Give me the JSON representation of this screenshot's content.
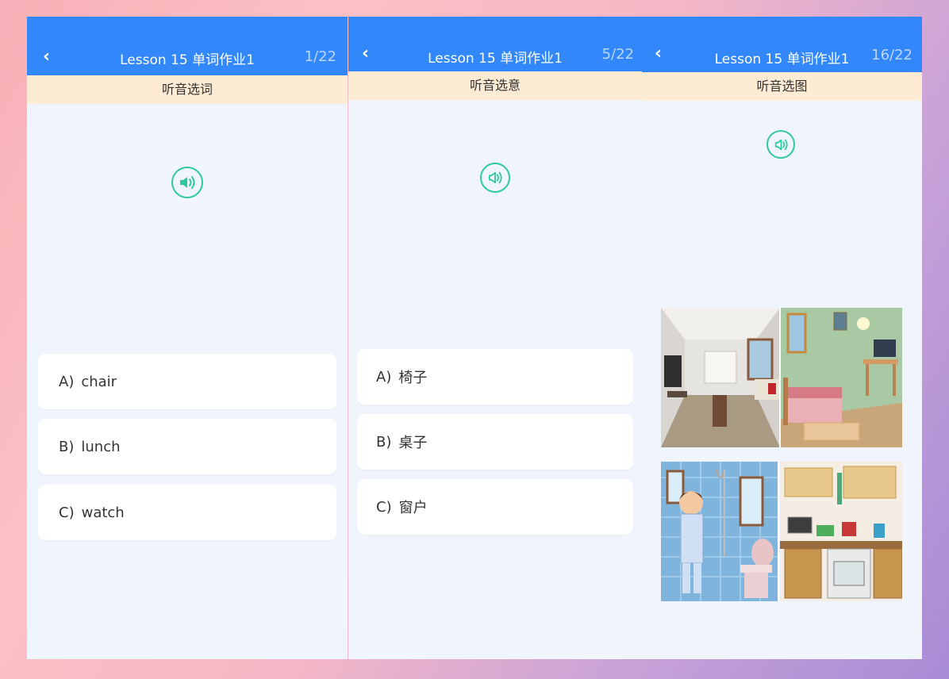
{
  "colors": {
    "header": "#3288fb",
    "subheader": "#fdecd3",
    "accent": "#2fc89a",
    "panel_bg": "#f0f5fd"
  },
  "panels": [
    {
      "back_icon": "chevron-left-icon",
      "title": "Lesson 15 单词作业1",
      "counter": "1/22",
      "subtitle": "听音选词",
      "speaker_icon": "speaker-icon",
      "options": [
        {
          "letter": "A)",
          "text": "chair"
        },
        {
          "letter": "B)",
          "text": "lunch"
        },
        {
          "letter": "C)",
          "text": "watch"
        }
      ]
    },
    {
      "back_icon": "chevron-left-icon",
      "title": "Lesson 15 单词作业1",
      "counter": "5/22",
      "subtitle": "听音选意",
      "speaker_icon": "speaker-icon",
      "options": [
        {
          "letter": "A)",
          "text": "椅子"
        },
        {
          "letter": "B)",
          "text": "桌子"
        },
        {
          "letter": "C)",
          "text": "窗户"
        }
      ]
    },
    {
      "back_icon": "chevron-left-icon",
      "title": "Lesson 15 单词作业1",
      "counter": "16/22",
      "subtitle": "听音选图",
      "speaker_icon": "speaker-icon",
      "images": [
        "living-room",
        "bedroom",
        "bathroom",
        "kitchen"
      ]
    }
  ]
}
